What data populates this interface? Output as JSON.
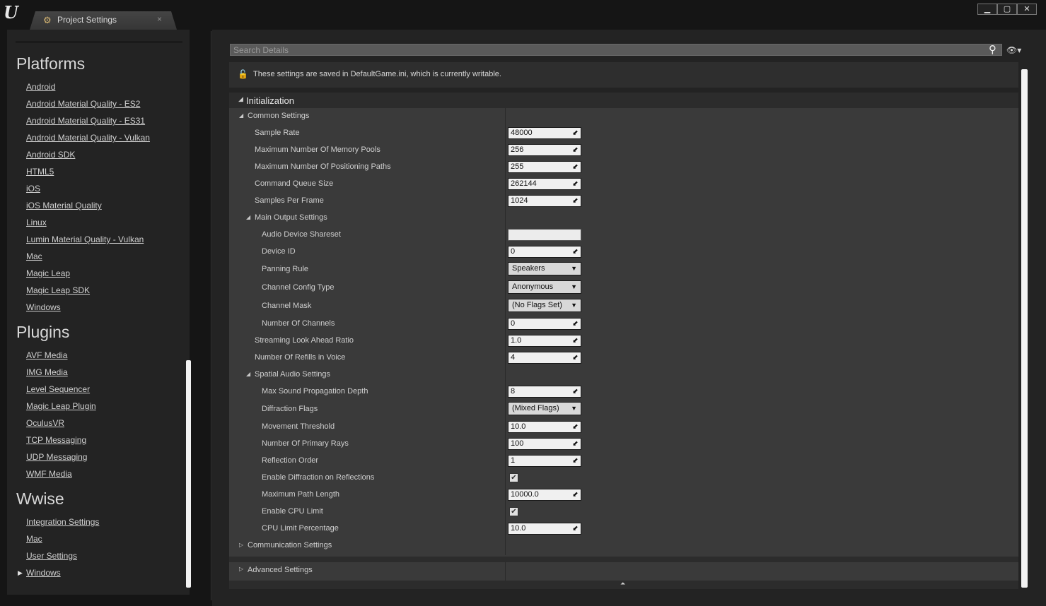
{
  "window": {
    "tab_title": "Project Settings",
    "tab_close": "×",
    "logo": "U",
    "buttons": [
      "▁",
      "▢",
      "✕"
    ]
  },
  "sidebar": {
    "sections": [
      {
        "title": "Platforms",
        "items": [
          "Android",
          "Android Material Quality - ES2",
          "Android Material Quality - ES31",
          "Android Material Quality - Vulkan",
          "Android SDK",
          "HTML5",
          "iOS",
          "iOS Material Quality",
          "Linux",
          "Lumin Material Quality - Vulkan",
          "Mac",
          "Magic Leap",
          "Magic Leap SDK",
          "Windows"
        ]
      },
      {
        "title": "Plugins",
        "items": [
          "AVF Media",
          "IMG Media",
          "Level Sequencer",
          "Magic Leap Plugin",
          "OculusVR",
          "TCP Messaging",
          "UDP Messaging",
          "WMF Media"
        ]
      },
      {
        "title": "Wwise",
        "items": [
          "Integration Settings",
          "Mac",
          "User Settings",
          "Windows"
        ]
      }
    ],
    "selected_marker": "▶"
  },
  "search": {
    "placeholder": "Search Details",
    "value": ""
  },
  "info": {
    "text": "These settings are saved in DefaultGame.ini, which is currently writable."
  },
  "details": {
    "category": "Initialization",
    "common_settings": "Common Settings",
    "rows": {
      "sample_rate": {
        "label": "Sample Rate",
        "value": "48000"
      },
      "max_memory_pools": {
        "label": "Maximum Number Of Memory Pools",
        "value": "256"
      },
      "max_positioning_paths": {
        "label": "Maximum Number Of Positioning Paths",
        "value": "255"
      },
      "command_queue_size": {
        "label": "Command Queue Size",
        "value": "262144"
      },
      "samples_per_frame": {
        "label": "Samples Per Frame",
        "value": "1024"
      },
      "main_output_settings": {
        "label": "Main Output Settings"
      },
      "audio_device_shareset": {
        "label": "Audio Device Shareset",
        "value": ""
      },
      "device_id": {
        "label": "Device ID",
        "value": "0"
      },
      "panning_rule": {
        "label": "Panning Rule",
        "value": "Speakers"
      },
      "channel_config_type": {
        "label": "Channel Config Type",
        "value": "Anonymous"
      },
      "channel_mask": {
        "label": "Channel Mask",
        "value": "(No Flags Set)"
      },
      "number_of_channels": {
        "label": "Number Of Channels",
        "value": "0"
      },
      "streaming_look_ahead": {
        "label": "Streaming Look Ahead Ratio",
        "value": "1.0"
      },
      "refills_in_voice": {
        "label": "Number Of Refills in Voice",
        "value": "4"
      },
      "spatial_audio_settings": {
        "label": "Spatial Audio Settings"
      },
      "max_sound_propagation": {
        "label": "Max Sound Propagation Depth",
        "value": "8"
      },
      "diffraction_flags": {
        "label": "Diffraction Flags",
        "value": "(Mixed Flags)"
      },
      "movement_threshold": {
        "label": "Movement Threshold",
        "value": "10.0"
      },
      "primary_rays": {
        "label": "Number Of Primary Rays",
        "value": "100"
      },
      "reflection_order": {
        "label": "Reflection Order",
        "value": "1"
      },
      "enable_diffraction_reflections": {
        "label": "Enable Diffraction on Reflections",
        "checked": true
      },
      "max_path_length": {
        "label": "Maximum Path Length",
        "value": "10000.0"
      },
      "enable_cpu_limit": {
        "label": "Enable CPU Limit",
        "checked": true
      },
      "cpu_limit_percentage": {
        "label": "CPU Limit Percentage",
        "value": "10.0"
      },
      "communication_settings": {
        "label": "Communication Settings"
      },
      "advanced_settings": {
        "label": "Advanced Settings"
      }
    }
  },
  "icons": {
    "expanded": "◢",
    "collapsed": "▷",
    "drag_handle": "⬋",
    "dropdown": "▼",
    "check": "✔",
    "search": "⚲",
    "eye": "👁▾",
    "lock": "🔓",
    "settings_tab": "⚙",
    "collapse_all": "⏶"
  }
}
